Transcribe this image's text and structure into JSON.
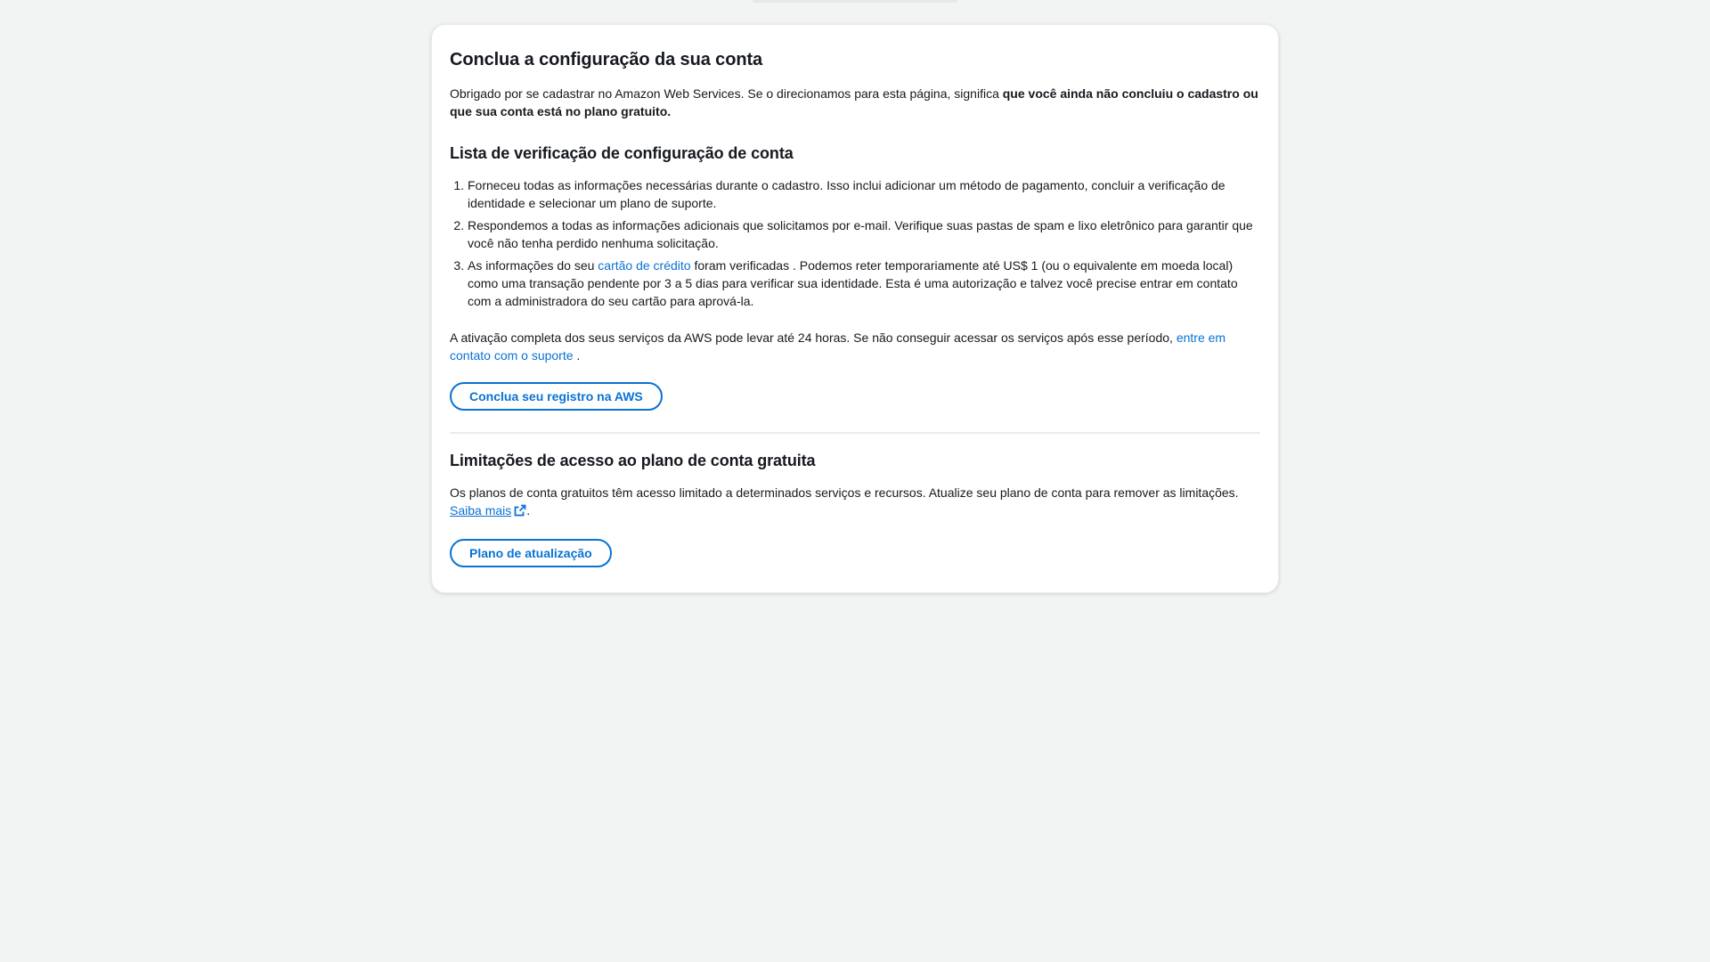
{
  "setup": {
    "title": "Conclua a configuração da sua conta",
    "intro_text": "Obrigado por se cadastrar no Amazon Web Services. Se o direcionamos para esta página, significa ",
    "intro_bold": "que você ainda não concluiu o cadastro ou que sua conta está no plano gratuito."
  },
  "checklist": {
    "title": "Lista de verificação de configuração de conta",
    "items": [
      {
        "text": "Forneceu todas as informações necessárias durante o cadastro. Isso inclui adicionar um método de pagamento, concluir a verificação de identidade e selecionar um plano de suporte."
      },
      {
        "text": "Respondemos a todas as informações adicionais que solicitamos por e-mail. Verifique suas pastas de spam e lixo eletrônico para garantir que você não tenha perdido nenhuma solicitação."
      },
      {
        "text_before": "As informações do seu ",
        "link": "cartão de crédito",
        "text_after": " foram verificadas . Podemos reter temporariamente até US$ 1 (ou o equivalente em moeda local) como uma transação pendente por 3 a 5 dias para verificar sua identidade. Esta é uma autorização e talvez você precise entrar em contato com a administradora do seu cartão para aprová-la."
      }
    ]
  },
  "activation": {
    "text_before": "A ativação completa dos seus serviços da AWS pode levar até 24 horas. Se não conseguir acessar os serviços após esse período, ",
    "link": "entre em contato com o suporte",
    "text_after": " ."
  },
  "complete_button": "Conclua seu registro na AWS",
  "limitations": {
    "title": "Limitações de acesso ao plano de conta gratuita",
    "text": "Os planos de conta gratuitos têm acesso limitado a determinados serviços e recursos. Atualize seu plano de conta para remover as limitações.",
    "learn_more": "Saiba mais",
    "after_link": "."
  },
  "upgrade_button": "Plano de atualização",
  "colors": {
    "page_bg": "#f2f3f3",
    "card_bg": "#ffffff",
    "link": "#0972d3",
    "text": "#16191f"
  },
  "icons": {
    "external_link": "external-link-icon"
  }
}
